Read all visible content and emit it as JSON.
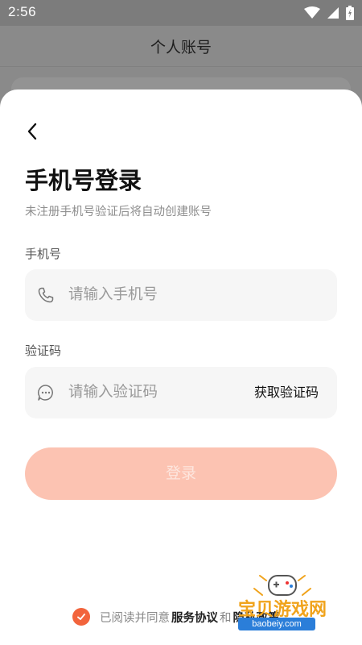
{
  "status_bar": {
    "time": "2:56"
  },
  "background_screen": {
    "title": "个人账号"
  },
  "login": {
    "title": "手机号登录",
    "subtitle": "未注册手机号验证后将自动创建账号",
    "phone_label": "手机号",
    "phone_placeholder": "请输入手机号",
    "code_label": "验证码",
    "code_placeholder": "请输入验证码",
    "get_code_label": "获取验证码",
    "submit_label": "登录",
    "agreement_prefix": "已阅读并同意",
    "service_agreement": "服务协议",
    "and_text": "和",
    "privacy_policy": "隐私政策"
  },
  "watermark": {
    "text": "宝贝游戏网",
    "url": "baobeiy.com"
  },
  "colors": {
    "accent": "#f2643c",
    "button_disabled": "#fcc3b2",
    "input_bg": "#f6f6f6",
    "watermark_yellow": "#f0a31c",
    "watermark_blue": "#2b7ed9"
  },
  "icons": {
    "back": "chevron-left-icon",
    "phone": "phone-icon",
    "message": "chat-bubble-icon",
    "check": "checkmark-icon"
  }
}
